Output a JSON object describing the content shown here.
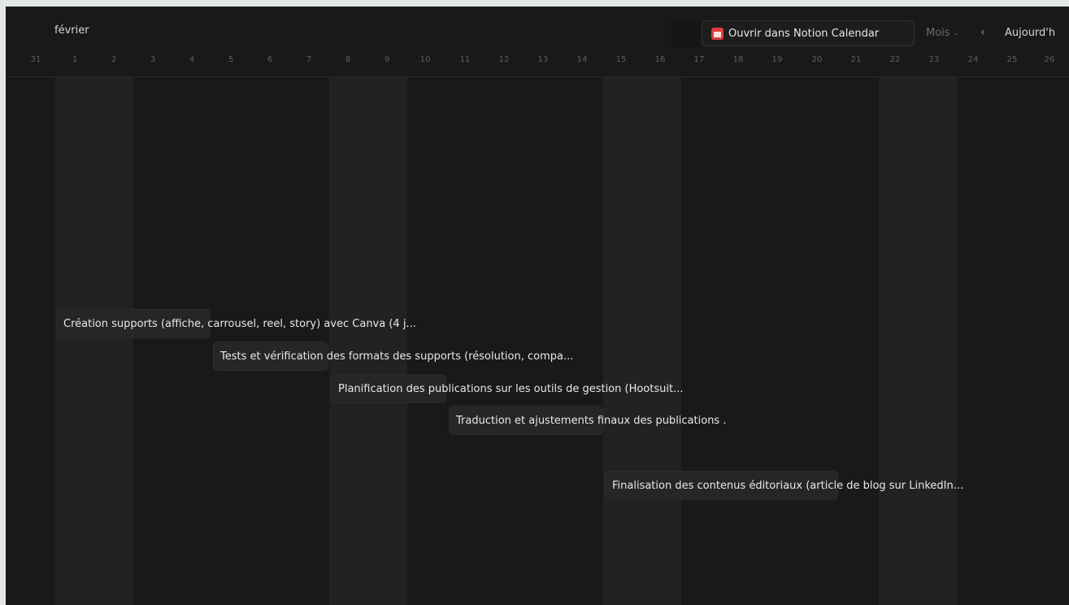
{
  "header": {
    "month": "février",
    "open_in_notion_label": "Ouvrir dans Notion Calendar",
    "view_label": "Mois",
    "today_label": "Aujourd'h"
  },
  "days": [
    "31",
    "1",
    "2",
    "3",
    "4",
    "5",
    "6",
    "7",
    "8",
    "9",
    "10",
    "11",
    "12",
    "13",
    "14",
    "15",
    "16",
    "17",
    "18",
    "19",
    "20",
    "21",
    "22",
    "23",
    "24",
    "25",
    "26"
  ],
  "events": [
    {
      "title": "Création supports (affiche, carrousel, reel, story) avec Canva (4 j..."
    },
    {
      "title": "Tests et vérification des formats des supports (résolution, compa..."
    },
    {
      "title": "Planification des publications sur les outils de gestion (Hootsuit..."
    },
    {
      "title": "Traduction et ajustements finaux des publications ."
    },
    {
      "title": "Finalisation des contenus éditoriaux (article de blog sur LinkedIn..."
    }
  ]
}
